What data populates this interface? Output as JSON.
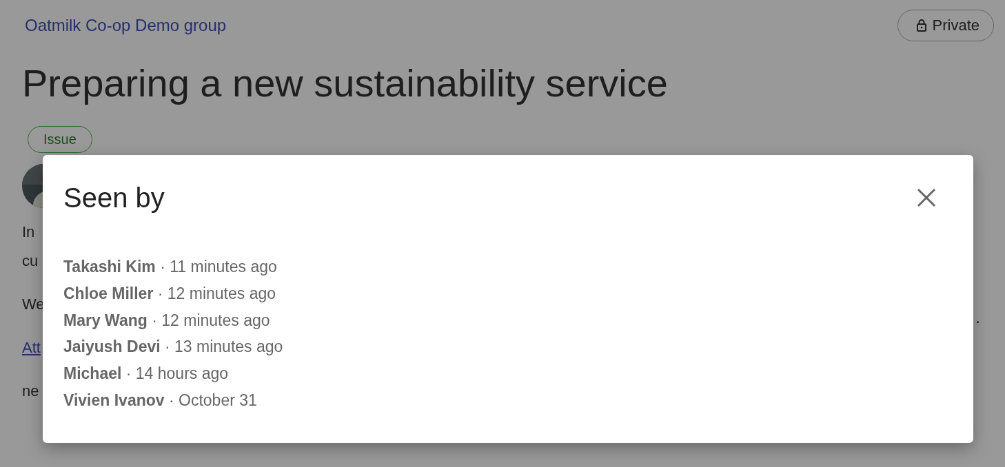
{
  "page": {
    "group": "Oatmilk Co-op Demo group",
    "privacy": "Private",
    "title": "Preparing a new sustainability service",
    "tag": "Issue",
    "body_fragments": [
      {
        "text": "In",
        "kind": "text"
      },
      {
        "text": "cu",
        "kind": "text"
      },
      {
        "text": "We",
        "kind": "text"
      },
      {
        "text": "Att",
        "kind": "link"
      },
      {
        "text": "ne",
        "kind": "text"
      }
    ],
    "trailing_mark": "."
  },
  "dialog": {
    "title": "Seen by",
    "viewers": [
      {
        "name": "Takashi Kim",
        "time": "· 11 minutes ago"
      },
      {
        "name": "Chloe Miller",
        "time": "· 12 minutes ago"
      },
      {
        "name": "Mary Wang",
        "time": "· 12 minutes ago"
      },
      {
        "name": "Jaiyush Devi",
        "time": "· 13 minutes ago"
      },
      {
        "name": "Michael",
        "time": "· 14 hours ago"
      },
      {
        "name": "Vivien Ivanov",
        "time": "· October 31"
      }
    ]
  }
}
